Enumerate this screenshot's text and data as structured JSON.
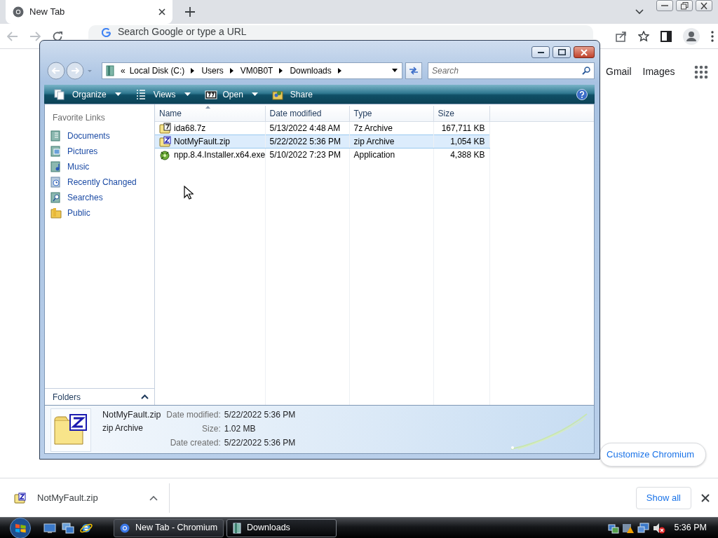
{
  "browser": {
    "tab": {
      "title": "New Tab"
    },
    "omnibox": {
      "placeholder": "Search Google or type a URL"
    },
    "links": [
      "Gmail",
      "Images"
    ],
    "customize_button": "Customize Chromium"
  },
  "explorer": {
    "breadcrumb_overflow": "«",
    "breadcrumb": [
      "Local Disk (C:)",
      "Users",
      "VM0B0T",
      "Downloads"
    ],
    "search": {
      "placeholder": "Search"
    },
    "toolbar": [
      {
        "label": "Organize",
        "kind": "organize",
        "dropdown": true
      },
      {
        "label": "Views",
        "kind": "views",
        "dropdown": true
      },
      {
        "label": "Open",
        "kind": "open",
        "dropdown": true
      },
      {
        "label": "Share",
        "kind": "share",
        "dropdown": false
      }
    ],
    "favorite_links": {
      "title": "Favorite Links",
      "items": [
        {
          "label": "Documents",
          "kind": "documents"
        },
        {
          "label": "Pictures",
          "kind": "pictures"
        },
        {
          "label": "Music",
          "kind": "music"
        },
        {
          "label": "Recently Changed",
          "kind": "recent"
        },
        {
          "label": "Searches",
          "kind": "searches"
        },
        {
          "label": "Public",
          "kind": "public"
        }
      ]
    },
    "folders": {
      "label": "Folders",
      "expanded": false
    },
    "columns": [
      {
        "label": "Name",
        "sorted": true
      },
      {
        "label": "Date modified",
        "sorted": false
      },
      {
        "label": "Type",
        "sorted": false
      },
      {
        "label": "Size",
        "sorted": false
      }
    ],
    "files": [
      {
        "name": "ida68.7z",
        "date_modified": "5/13/2022 4:48 AM",
        "type": "7z Archive",
        "size": "167,711 KB",
        "kind": "sevenzip",
        "selected": false
      },
      {
        "name": "NotMyFault.zip",
        "date_modified": "5/22/2022 5:36 PM",
        "type": "zip Archive",
        "size": "1,054 KB",
        "kind": "zip",
        "selected": true
      },
      {
        "name": "npp.8.4.Installer.x64.exe",
        "date_modified": "5/10/2022 7:23 PM",
        "type": "Application",
        "size": "4,388 KB",
        "kind": "exe",
        "selected": false
      }
    ],
    "details": {
      "name": "NotMyFault.zip",
      "type": "zip Archive",
      "fields": [
        {
          "label": "Date modified:",
          "value": "5/22/2022 5:36 PM"
        },
        {
          "label": "Size:",
          "value": "1.02 MB"
        },
        {
          "label": "Date created:",
          "value": "5/22/2022 5:36 PM"
        }
      ]
    }
  },
  "downloads_bar": {
    "items": [
      {
        "name": "NotMyFault.zip"
      }
    ],
    "show_all": "Show all"
  },
  "taskbar": {
    "tasks": [
      {
        "label": "New Tab - Chromium",
        "kind": "browser",
        "selected": false
      },
      {
        "label": "Downloads",
        "kind": "folder",
        "selected": true
      }
    ],
    "clock": "5:36 PM"
  }
}
